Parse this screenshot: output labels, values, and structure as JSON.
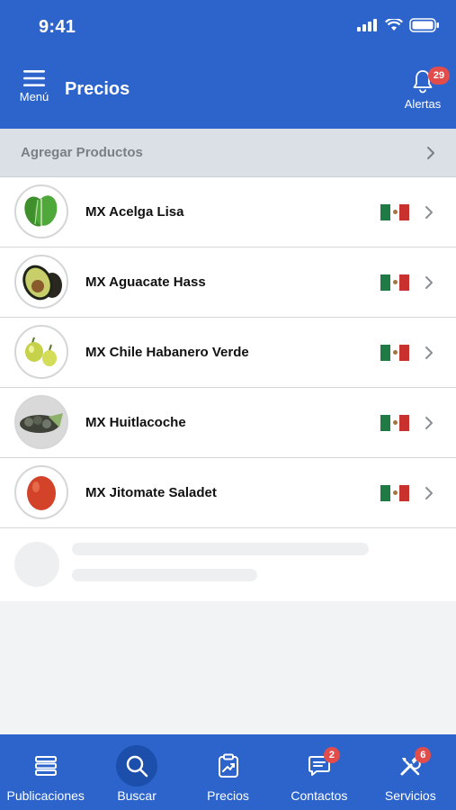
{
  "status_bar": {
    "time": "9:41"
  },
  "header": {
    "menu_label": "Menú",
    "title": "Precios",
    "alerts_label": "Alertas",
    "alerts_count": "29"
  },
  "add_products": {
    "label": "Agregar Productos"
  },
  "products": [
    {
      "name": "MX Acelga Lisa",
      "icon": "chard-leaf"
    },
    {
      "name": "MX Aguacate Hass",
      "icon": "avocado"
    },
    {
      "name": "MX Chile Habanero Verde",
      "icon": "habanero-chili"
    },
    {
      "name": "MX Huitlacoche",
      "icon": "huitlacoche"
    },
    {
      "name": "MX Jitomate Saladet",
      "icon": "tomato"
    }
  ],
  "tabs": [
    {
      "label": "Publicaciones",
      "icon": "stack-icon",
      "badge": null,
      "active": false
    },
    {
      "label": "Buscar",
      "icon": "search-icon",
      "badge": null,
      "active": true
    },
    {
      "label": "Precios",
      "icon": "clipboard-chart-icon",
      "badge": null,
      "active": false
    },
    {
      "label": "Contactos",
      "icon": "message-icon",
      "badge": "2",
      "active": false
    },
    {
      "label": "Servicios",
      "icon": "tools-icon",
      "badge": "6",
      "active": false
    }
  ],
  "colors": {
    "primary": "#2d64cc",
    "active_tab": "#1c4fab",
    "badge": "#e24c4b",
    "flag_green": "#1f7a46",
    "flag_red": "#c8312d"
  }
}
